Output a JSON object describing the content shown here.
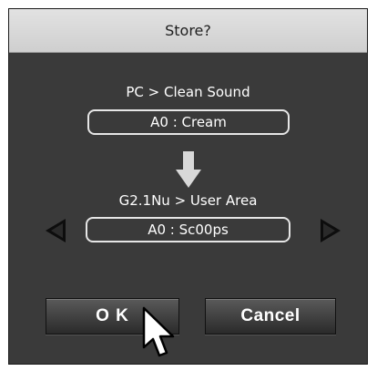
{
  "dialog": {
    "title": "Store?"
  },
  "source": {
    "path": "PC > Clean Sound",
    "value": "A0 : Cream"
  },
  "destination": {
    "path": "G2.1Nu > User Area",
    "value": "A0 : Sc00ps"
  },
  "buttons": {
    "ok_label": "O K",
    "cancel_label": "Cancel"
  },
  "icons": {
    "transfer": "down-arrow-icon",
    "previous": "left-triangle-icon",
    "next": "right-triangle-icon",
    "pointer": "mouse-cursor-icon"
  },
  "colors": {
    "dialog_background": "#3a3a3a",
    "titlebar_background": "#d8d8d8",
    "text": "#ffffff",
    "field_border": "#e6e6e6"
  }
}
